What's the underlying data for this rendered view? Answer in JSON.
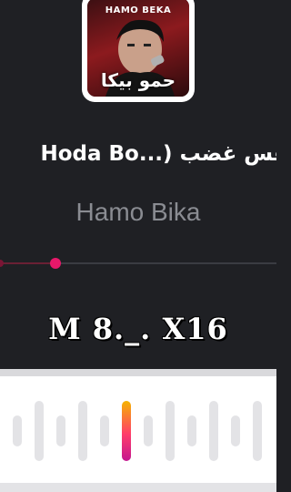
{
  "album_art": {
    "top_text": "HAMO BEKA",
    "arabic_text": "حمو بيكا"
  },
  "song": {
    "title": "Hoda Bo...) ‎نفس غضب"
  },
  "artist": "Hamo Bika",
  "progress": {
    "fraction": 0.2
  },
  "caption": "M 8._. X16",
  "colors": {
    "background": "#1f2024",
    "accent": "#e8186a",
    "panel": "#ffffff"
  },
  "waveform": {
    "active_index": 5
  }
}
